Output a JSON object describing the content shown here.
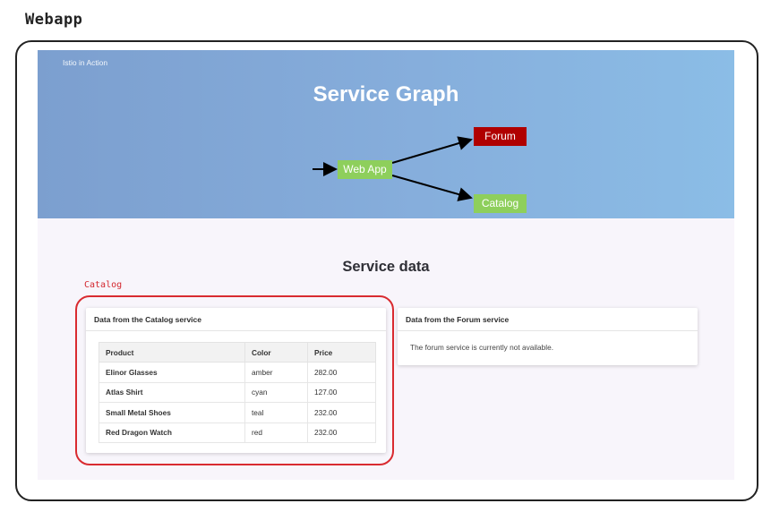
{
  "figure": {
    "title": "Webapp"
  },
  "hero": {
    "brand": "Istio in Action",
    "title": "Service Graph",
    "nodes": {
      "webapp": "Web App",
      "forum": "Forum",
      "catalog": "Catalog"
    },
    "colors": {
      "healthy": "#8ecf5c",
      "unavailable": "#b00000"
    }
  },
  "section": {
    "title": "Service data"
  },
  "catalog_card": {
    "header": "Data from the Catalog service",
    "columns": [
      "Product",
      "Color",
      "Price"
    ],
    "rows": [
      [
        "Elinor Glasses",
        "amber",
        "282.00"
      ],
      [
        "Atlas Shirt",
        "cyan",
        "127.00"
      ],
      [
        "Small Metal Shoes",
        "teal",
        "232.00"
      ],
      [
        "Red Dragon Watch",
        "red",
        "232.00"
      ]
    ]
  },
  "forum_card": {
    "header": "Data from the Forum service",
    "message": "The forum service is currently not available."
  },
  "annotation": {
    "label": "Catalog",
    "color": "#d92b30"
  }
}
